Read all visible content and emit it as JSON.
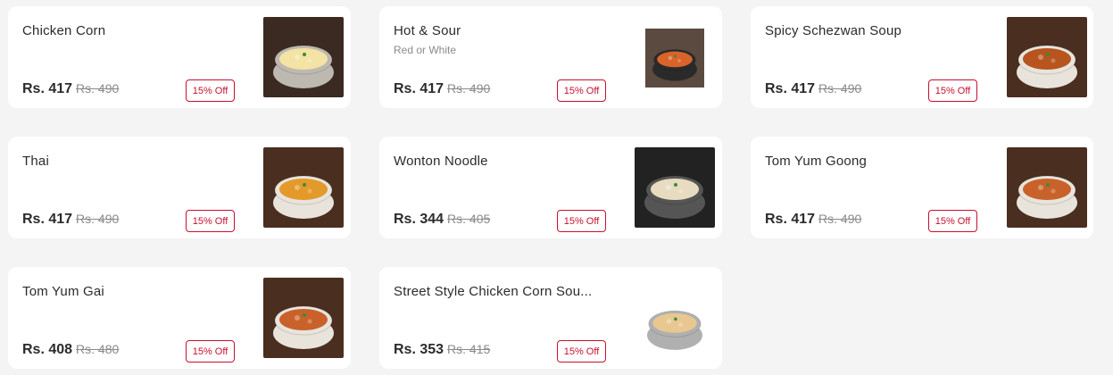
{
  "items": [
    {
      "name": "Chicken Corn",
      "subtitle": "",
      "price": "Rs. 417",
      "original_price": "Rs. 490",
      "discount": "15% Off",
      "soup_color": "#f3e3a4",
      "bg_color": "#3a2a22",
      "bowl_color": "#bdb8b0"
    },
    {
      "name": "Hot & Sour",
      "subtitle": "Red or White",
      "price": "Rs. 417",
      "original_price": "Rs. 490",
      "discount": "15% Off",
      "soup_color": "#d9632a",
      "bg_color": "#5a4a40",
      "bowl_color": "#2a2a2a"
    },
    {
      "name": "Spicy Schezwan Soup",
      "subtitle": "",
      "price": "Rs. 417",
      "original_price": "Rs. 490",
      "discount": "15% Off",
      "soup_color": "#b8541e",
      "bg_color": "#4a2e20",
      "bowl_color": "#e8e4dc"
    },
    {
      "name": "Thai",
      "subtitle": "",
      "price": "Rs. 417",
      "original_price": "Rs. 490",
      "discount": "15% Off",
      "soup_color": "#e39a2a",
      "bg_color": "#4a2e20",
      "bowl_color": "#e8e4dc"
    },
    {
      "name": "Wonton Noodle",
      "subtitle": "",
      "price": "Rs. 344",
      "original_price": "Rs. 405",
      "discount": "15% Off",
      "soup_color": "#e8dcc0",
      "bg_color": "#222222",
      "bowl_color": "#555555"
    },
    {
      "name": "Tom Yum Goong",
      "subtitle": "",
      "price": "Rs. 417",
      "original_price": "Rs. 490",
      "discount": "15% Off",
      "soup_color": "#c9622a",
      "bg_color": "#4a2e20",
      "bowl_color": "#e8e4dc"
    },
    {
      "name": "Tom Yum Gai",
      "subtitle": "",
      "price": "Rs. 408",
      "original_price": "Rs. 480",
      "discount": "15% Off",
      "soup_color": "#c9622a",
      "bg_color": "#4a2e20",
      "bowl_color": "#e8e4dc"
    },
    {
      "name": "Street Style Chicken Corn Sou...",
      "subtitle": "",
      "price": "Rs. 353",
      "original_price": "Rs. 415",
      "discount": "15% Off",
      "soup_color": "#e8c890",
      "bg_color": "#ffffff",
      "bowl_color": "#b0b0b0"
    }
  ]
}
